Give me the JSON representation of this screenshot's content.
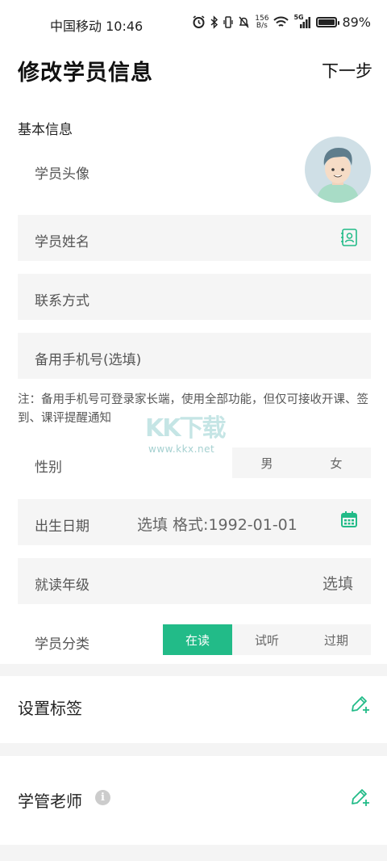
{
  "status_bar": {
    "carrier_time": "中国移动 10:46",
    "net_speed_value": "156",
    "net_speed_unit": "B/s",
    "signal_label": "5G",
    "battery": "89%",
    "battery_level": 0.89
  },
  "header": {
    "title": "修改学员信息",
    "next_label": "下一步"
  },
  "basic_info": {
    "section_label": "基本信息",
    "avatar_label": "学员头像",
    "name_placeholder": "学员姓名",
    "contact_placeholder": "联系方式",
    "backup_phone_placeholder": "备用手机号(选填)",
    "note": "注：备用手机号可登录家长端，使用全部功能，但仅可接收开课、签到、课评提醒通知"
  },
  "gender": {
    "label": "性别",
    "options": [
      "男",
      "女"
    ]
  },
  "birthday": {
    "label": "出生日期",
    "placeholder": "选填 格式:1992-01-01"
  },
  "grade": {
    "label": "就读年级",
    "value": "选填"
  },
  "category": {
    "label": "学员分类",
    "options": [
      "在读",
      "试听",
      "过期"
    ],
    "selected": "在读"
  },
  "tags": {
    "title": "设置标签"
  },
  "manager": {
    "title": "学管老师"
  },
  "watermark": {
    "brand": "KK下载",
    "url": "www.kkx.net"
  },
  "colors": {
    "accent": "#22bb88",
    "field_bg": "#f5f5f5"
  }
}
